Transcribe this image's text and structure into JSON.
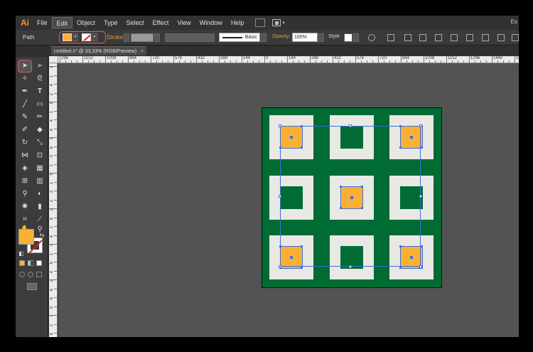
{
  "app": {
    "logo": "Ai",
    "workspace": "Es"
  },
  "menu": [
    "File",
    "Edit",
    "Object",
    "Type",
    "Select",
    "Effect",
    "View",
    "Window",
    "Help"
  ],
  "control_bar": {
    "selection_type": "Path",
    "stroke_label": "Stroke:",
    "brush_label": "Basic",
    "opacity_label": "Opacity:",
    "opacity_value": "100%",
    "style_label": "Style:"
  },
  "document_tab": {
    "title": "Untitled-1* @ 33,33% (RGB/Preview)",
    "close": "×"
  },
  "ruler": {
    "top": [
      "296",
      "1152",
      "1008",
      "864",
      "720",
      "576",
      "432",
      "288",
      "144",
      "0",
      "144",
      "288",
      "432",
      "576",
      "720",
      "864",
      "1008",
      "1152",
      "1296",
      "1440",
      "158"
    ],
    "left": [
      "1",
      "1",
      "4",
      "2",
      "8",
      "1",
      "4",
      "4",
      "1",
      "6",
      "0",
      "1",
      "6",
      "1",
      "3",
      "2",
      "2",
      "8",
      "1",
      "4",
      "3",
      "1",
      "6",
      "4",
      "2",
      "6",
      "6",
      "0",
      "7",
      "2",
      "8"
    ]
  },
  "colors": {
    "fill": "#fbb034",
    "artboard_bg": "#006b33",
    "tile": "#e8e8e5",
    "selection": "#3f6fd8",
    "highlight": "#e05a63"
  },
  "icons": {
    "selection_tool": "selection-arrow-icon",
    "direct_selection_tool": "direct-selection-arrow-icon",
    "magic_wand": "magic-wand-icon",
    "lasso": "lasso-icon",
    "pen": "pen-icon",
    "type": "type-icon",
    "line": "line-segment-icon",
    "rectangle": "rectangle-icon",
    "paintbrush": "paintbrush-icon",
    "pencil": "pencil-icon",
    "hand": "hand-icon",
    "zoom": "zoom-icon"
  },
  "artwork": {
    "grid": [
      [
        "orange",
        "green",
        "orange"
      ],
      [
        "green",
        "orange",
        "green"
      ],
      [
        "orange",
        "green",
        "orange"
      ]
    ]
  }
}
